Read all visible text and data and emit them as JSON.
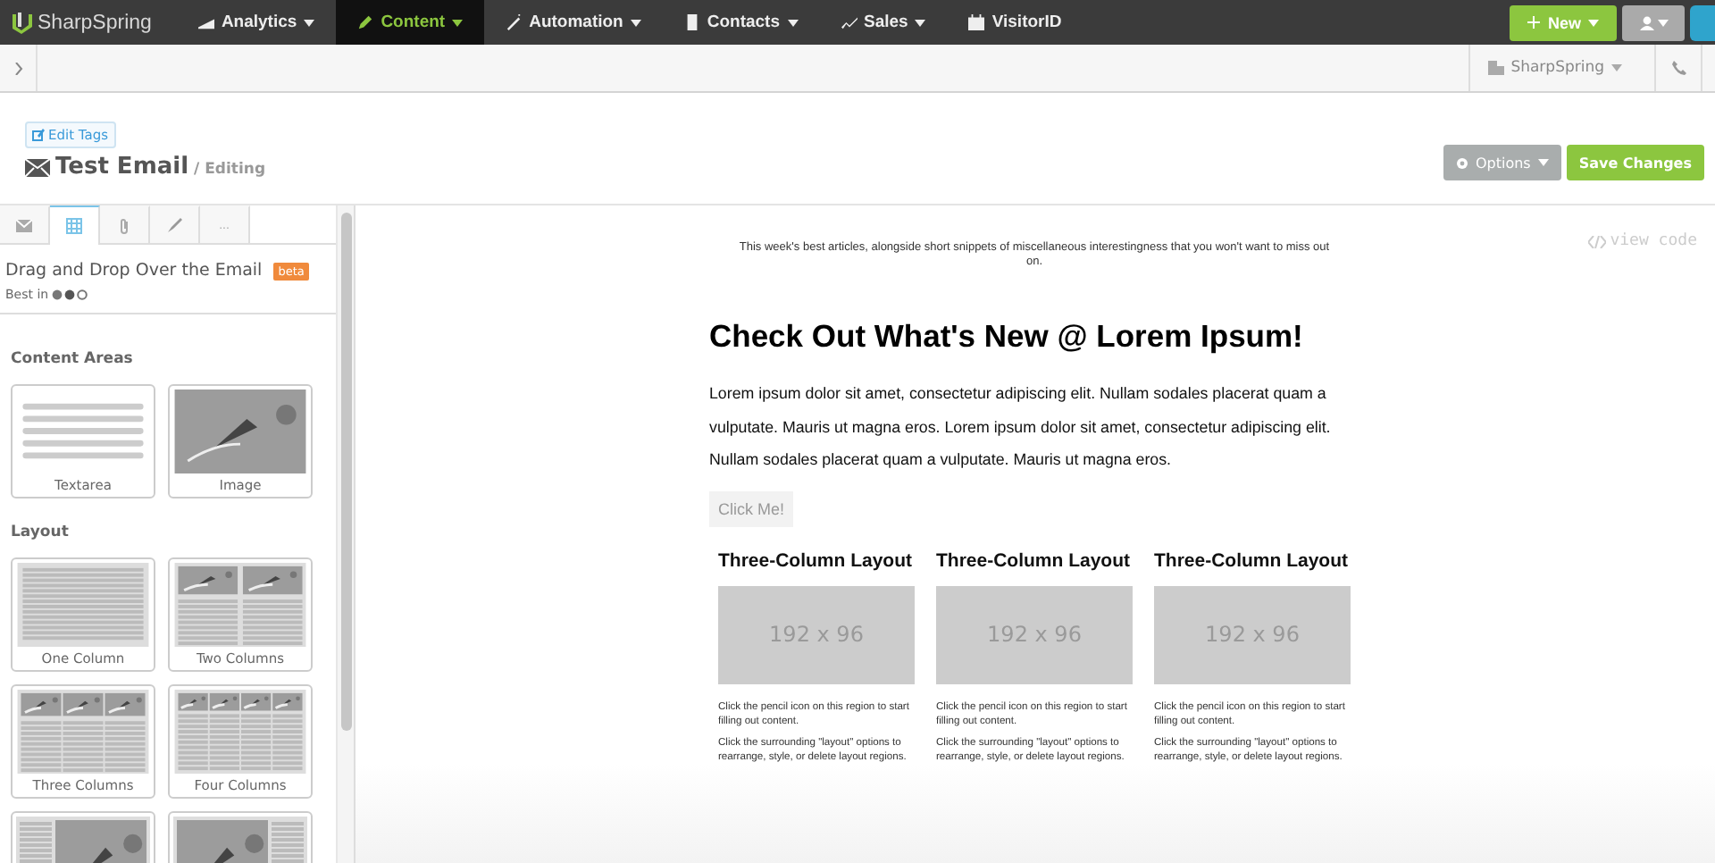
{
  "top_nav": {
    "logo": "SharpSpring",
    "items": [
      {
        "label": "Analytics",
        "dropdown": true,
        "selected": false
      },
      {
        "label": "Content",
        "dropdown": true,
        "selected": true
      },
      {
        "label": "Automation",
        "dropdown": true,
        "selected": false
      },
      {
        "label": "Contacts",
        "dropdown": true,
        "selected": false
      },
      {
        "label": "Sales",
        "dropdown": true,
        "selected": false
      },
      {
        "label": "VisitorID",
        "dropdown": false,
        "selected": false
      }
    ],
    "new_button": "New"
  },
  "sub_bar": {
    "account": "SharpSpring"
  },
  "header": {
    "edit_tags": "Edit Tags",
    "title": "Test Email",
    "subtitle": "/ Editing",
    "options_button": "Options",
    "save_button": "Save Changes"
  },
  "panel": {
    "tabs": [
      {
        "selected": false
      },
      {
        "selected": true
      },
      {
        "selected": false
      },
      {
        "selected": false
      },
      {
        "label": "...",
        "selected": false
      }
    ],
    "title": "Drag and Drop Over the Email",
    "badge": "beta",
    "best_in": "Best in",
    "sections": [
      {
        "heading": "Content Areas",
        "blocks": [
          {
            "label": "Textarea",
            "kind": "text"
          },
          {
            "label": "Image",
            "kind": "image"
          }
        ]
      },
      {
        "heading": "Layout",
        "blocks": [
          {
            "label": "One Column",
            "kind": "one"
          },
          {
            "label": "Two Columns",
            "kind": "two"
          },
          {
            "label": "Three Columns",
            "kind": "three"
          },
          {
            "label": "Four Columns",
            "kind": "four"
          },
          {
            "kind": "left"
          },
          {
            "kind": "right"
          }
        ]
      }
    ]
  },
  "email": {
    "view_code": "view code",
    "preheader": "This week's best articles, alongside short snippets of miscellaneous interestingness that you won't want to miss out on.",
    "heading": "Check Out What's New @ Lorem Ipsum!",
    "body": "Lorem ipsum dolor sit amet, consectetur adipiscing elit. Nullam sodales placerat quam a vulputate. Mauris ut magna eros. Lorem ipsum dolor sit amet, consectetur adipiscing elit. Nullam sodales placerat quam a vulputate. Mauris ut magna eros.",
    "button": "Click Me!",
    "columns": [
      {
        "heading": "Three-Column Layout",
        "placeholder": "192 x 96",
        "text_1": "Click the pencil icon on this region to start filling out content.",
        "text_2": "Click the surrounding \"layout\" options to rearrange, style, or delete layout regions."
      },
      {
        "heading": "Three-Column Layout",
        "placeholder": "192 x 96",
        "text_1": "Click the pencil icon on this region to start filling out content.",
        "text_2": "Click the surrounding \"layout\" options to rearrange, style, or delete layout regions."
      },
      {
        "heading": "Three-Column Layout",
        "placeholder": "192 x 96",
        "text_1": "Click the pencil icon on this region to start filling out content.",
        "text_2": "Click the surrounding \"layout\" options to rearrange, style, or delete layout regions."
      }
    ]
  }
}
